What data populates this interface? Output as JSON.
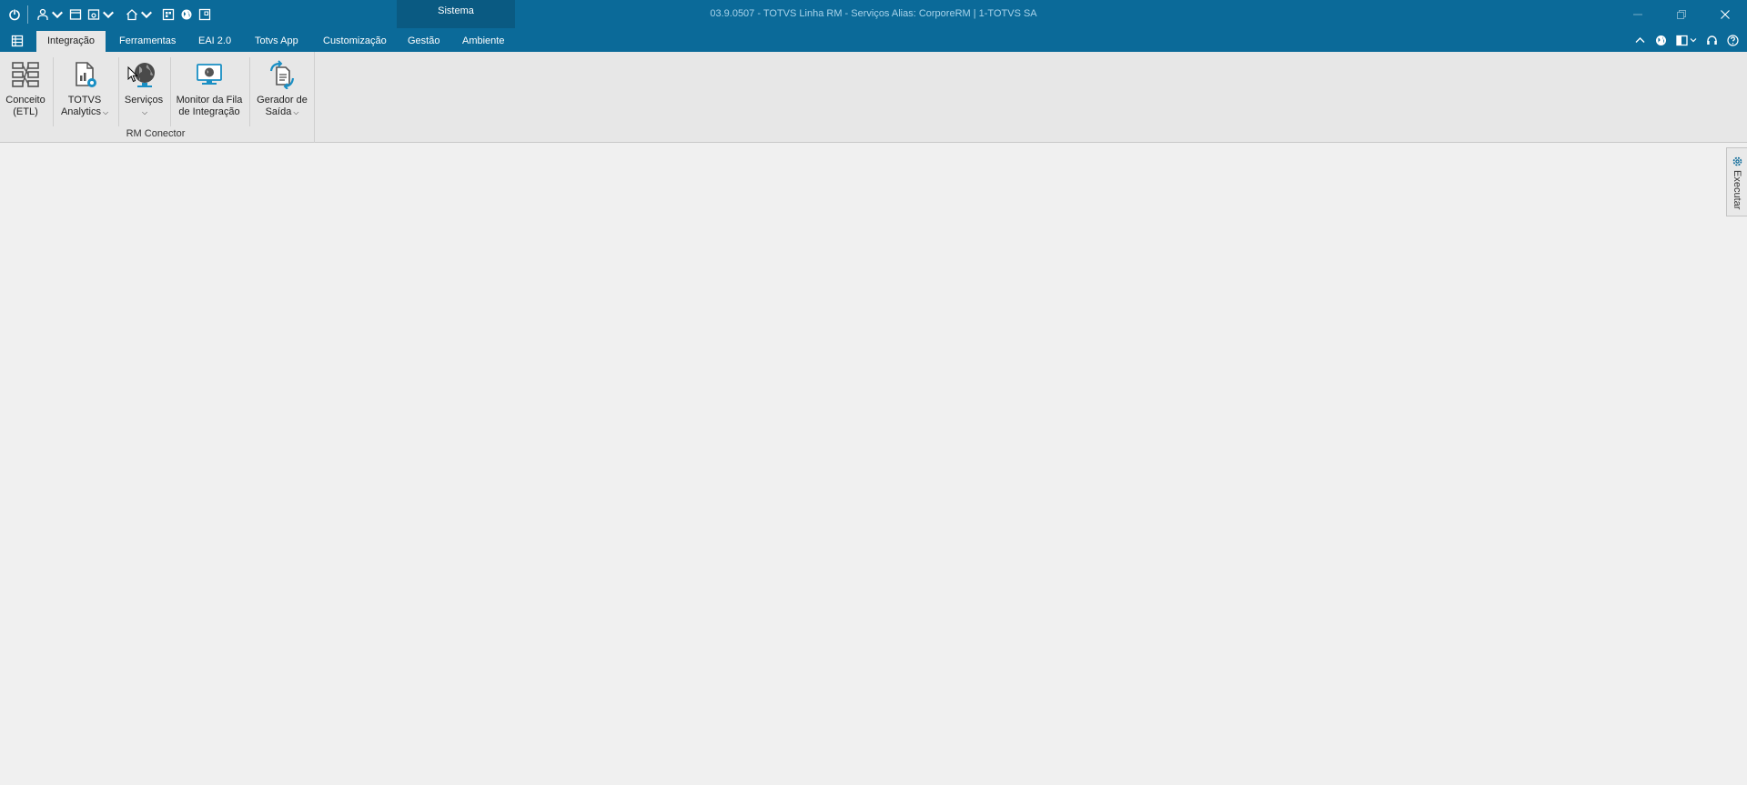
{
  "window": {
    "title": "03.9.0507 - TOTVS Linha RM - Serviços  Alias: CorporeRM | 1-TOTVS SA",
    "context_group": "Sistema",
    "controls": [
      "minimize-icon",
      "restore-icon",
      "close-icon"
    ]
  },
  "quick_access": [
    {
      "icon": "power-icon",
      "dropdown": false
    },
    {
      "icon": "users-icon",
      "dropdown": true
    },
    {
      "icon": "window-icon",
      "dropdown": false
    },
    {
      "icon": "eye-window-icon",
      "dropdown": true
    },
    {
      "icon": "home-icon",
      "dropdown": true
    },
    {
      "icon": "grid-window-icon",
      "dropdown": false
    },
    {
      "icon": "globe-icon",
      "dropdown": false
    },
    {
      "icon": "panel-icon",
      "dropdown": false
    }
  ],
  "tabs": [
    {
      "label": "Integração",
      "active": true
    },
    {
      "label": "Ferramentas",
      "active": false
    },
    {
      "label": "EAI 2.0",
      "active": false
    },
    {
      "label": "Totvs App",
      "active": false
    },
    {
      "label": "Customização",
      "active": false
    },
    {
      "label": "Gestão",
      "active": false
    },
    {
      "label": "Ambiente",
      "active": false
    }
  ],
  "ribbon": {
    "group_caption": "RM Conector",
    "buttons": [
      {
        "label1": "Conceito",
        "label2": "(ETL)",
        "dropdown": false,
        "icon": "etl-icon"
      },
      {
        "label1": "TOTVS",
        "label2": "Analytics",
        "dropdown": true,
        "icon": "analytics-icon"
      },
      {
        "label1": "Serviços",
        "label2": "",
        "dropdown": true,
        "icon": "services-globe-icon"
      },
      {
        "label1": "Monitor da Fila",
        "label2": "de Integração",
        "dropdown": false,
        "icon": "monitor-icon"
      },
      {
        "label1": "Gerador de",
        "label2": "Saída",
        "dropdown": true,
        "icon": "output-generator-icon"
      }
    ]
  },
  "dock_panel": {
    "label": "Executar"
  },
  "colors": {
    "titlebar": "#0b6a99",
    "context_group": "#0a5a82",
    "ribbon_bg": "#e7e7e7",
    "workspace_bg": "#f0f0f0",
    "accent": "#1a8fc4"
  }
}
